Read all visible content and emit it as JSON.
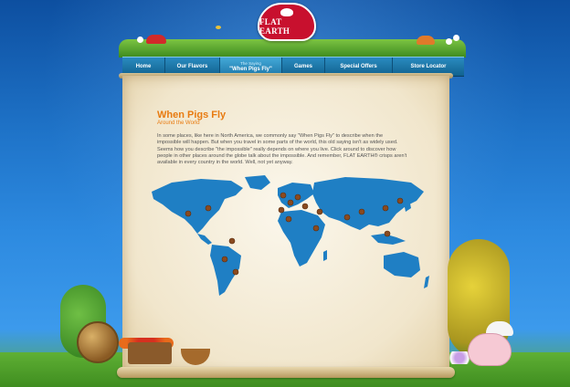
{
  "brand": {
    "name": "FLAT EARTH",
    "tagline": ""
  },
  "nav": {
    "items": [
      {
        "label": "Home"
      },
      {
        "label": "Our Flavors"
      },
      {
        "kicker": "The Saying",
        "label": "\"When Pigs Fly\"",
        "active": true
      },
      {
        "label": "Games"
      },
      {
        "label": "Special Offers"
      },
      {
        "label": "Store Locator"
      }
    ]
  },
  "content": {
    "title": "When Pigs Fly",
    "subtitle": "Around the World",
    "body": "In some places, like here in North America, we commonly say \"When Pigs Fly\" to describe when the impossible will happen. But when you travel in some parts of the world, this old saying isn't as widely used. Seems how you describe \"the impossible\" really depends on where you live. Click around to discover how people in other places around the globe talk about the impossible. And remember, FLAT EARTH® crisps aren't available in every country in the world. Well, not yet anyway."
  },
  "map": {
    "pins_count": 18
  },
  "colors": {
    "accent_orange": "#e87b11",
    "nav_blue": "#1d78aa",
    "map_blue": "#1f7fc4",
    "brand_red": "#c8102e",
    "pin_brown": "#8a4a1f"
  }
}
